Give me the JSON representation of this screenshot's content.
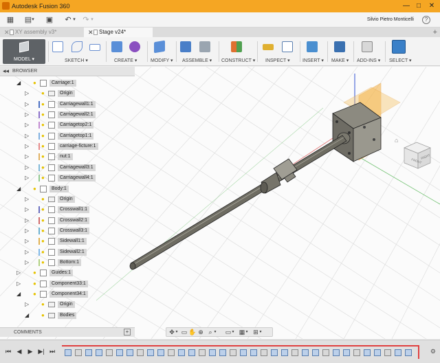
{
  "window": {
    "title": "Autodesk Fusion 360",
    "minimize": "—",
    "maximize": "□",
    "close": "✕"
  },
  "quickbar": {
    "user": "Silvio Pietro Monticelli",
    "help": "?"
  },
  "tabs": [
    {
      "label": "XY assembly v3*",
      "active": false
    },
    {
      "label": "Stage v24*",
      "active": true
    }
  ],
  "toolbar": {
    "model": "MODEL ▾",
    "groups": [
      "SKETCH ▾",
      "CREATE ▾",
      "MODIFY ▾",
      "ASSEMBLE ▾",
      "CONSTRUCT ▾",
      "INSPECT ▾",
      "INSERT ▾",
      "MAKE ▾",
      "ADD-INS ▾",
      "SELECT ▾"
    ]
  },
  "browser": {
    "title": "BROWSER",
    "items": [
      {
        "label": "Carriage:1",
        "level": 0,
        "type": "component",
        "arrow": "◢"
      },
      {
        "label": "Origin",
        "level": 1,
        "type": "folder",
        "arrow": "▷"
      },
      {
        "label": "Carriagewall1:1",
        "level": 1,
        "type": "body",
        "arrow": "▷",
        "color": "#4a6fc2"
      },
      {
        "label": "Carriagewall2:1",
        "level": 1,
        "type": "body",
        "arrow": "▷",
        "color": "#8a6fc8"
      },
      {
        "label": "Carriagetop2:1",
        "level": 1,
        "type": "body",
        "arrow": "▷",
        "color": "#c28ad0"
      },
      {
        "label": "Carriagetop1:1",
        "level": 1,
        "type": "body",
        "arrow": "▷",
        "color": "#7fb0e0"
      },
      {
        "label": "carriage-ficture:1",
        "level": 1,
        "type": "body",
        "arrow": "▷",
        "color": "#e68a8a"
      },
      {
        "label": "nut:1",
        "level": 1,
        "type": "body",
        "arrow": "▷",
        "color": "#e0b060"
      },
      {
        "label": "Carriagewall3:1",
        "level": 1,
        "type": "body",
        "arrow": "▷",
        "color": "#7fb8d8"
      },
      {
        "label": "Carriagewall4:1",
        "level": 1,
        "type": "body",
        "arrow": "▷",
        "color": "#90c890"
      },
      {
        "label": "Body:1",
        "level": 0,
        "type": "component",
        "arrow": "◢"
      },
      {
        "label": "Origin",
        "level": 1,
        "type": "folder",
        "arrow": "▷"
      },
      {
        "label": "Crosswall1:1",
        "level": 1,
        "type": "body",
        "arrow": "▷",
        "color": "#6a6fc0"
      },
      {
        "label": "Crosswall2:1",
        "level": 1,
        "type": "body",
        "arrow": "▷",
        "color": "#d06a6a"
      },
      {
        "label": "Crosswall3:1",
        "level": 1,
        "type": "body",
        "arrow": "▷",
        "color": "#6ab0d0"
      },
      {
        "label": "Sidewall1:1",
        "level": 1,
        "type": "body",
        "arrow": "▷",
        "color": "#e0b050"
      },
      {
        "label": "Sidewall2:1",
        "level": 1,
        "type": "body",
        "arrow": "▷",
        "color": "#7fb8e8"
      },
      {
        "label": "Bottom:1",
        "level": 1,
        "type": "body",
        "arrow": "▷",
        "color": "#b0d080"
      },
      {
        "label": "Guides:1",
        "level": 0,
        "type": "component",
        "arrow": "▷"
      },
      {
        "label": "Component33:1",
        "level": 0,
        "type": "component",
        "arrow": "▷"
      },
      {
        "label": "Component34:1",
        "level": 0,
        "type": "component",
        "arrow": "◢"
      },
      {
        "label": "Origin",
        "level": 1,
        "type": "folder",
        "arrow": "▷"
      },
      {
        "label": "Bodies",
        "level": 1,
        "type": "folder",
        "arrow": "◢"
      }
    ]
  },
  "comments": {
    "title": "COMMENTS",
    "add": "+"
  },
  "viewcube": {
    "front": "FRONT",
    "right": "RIGHT"
  }
}
